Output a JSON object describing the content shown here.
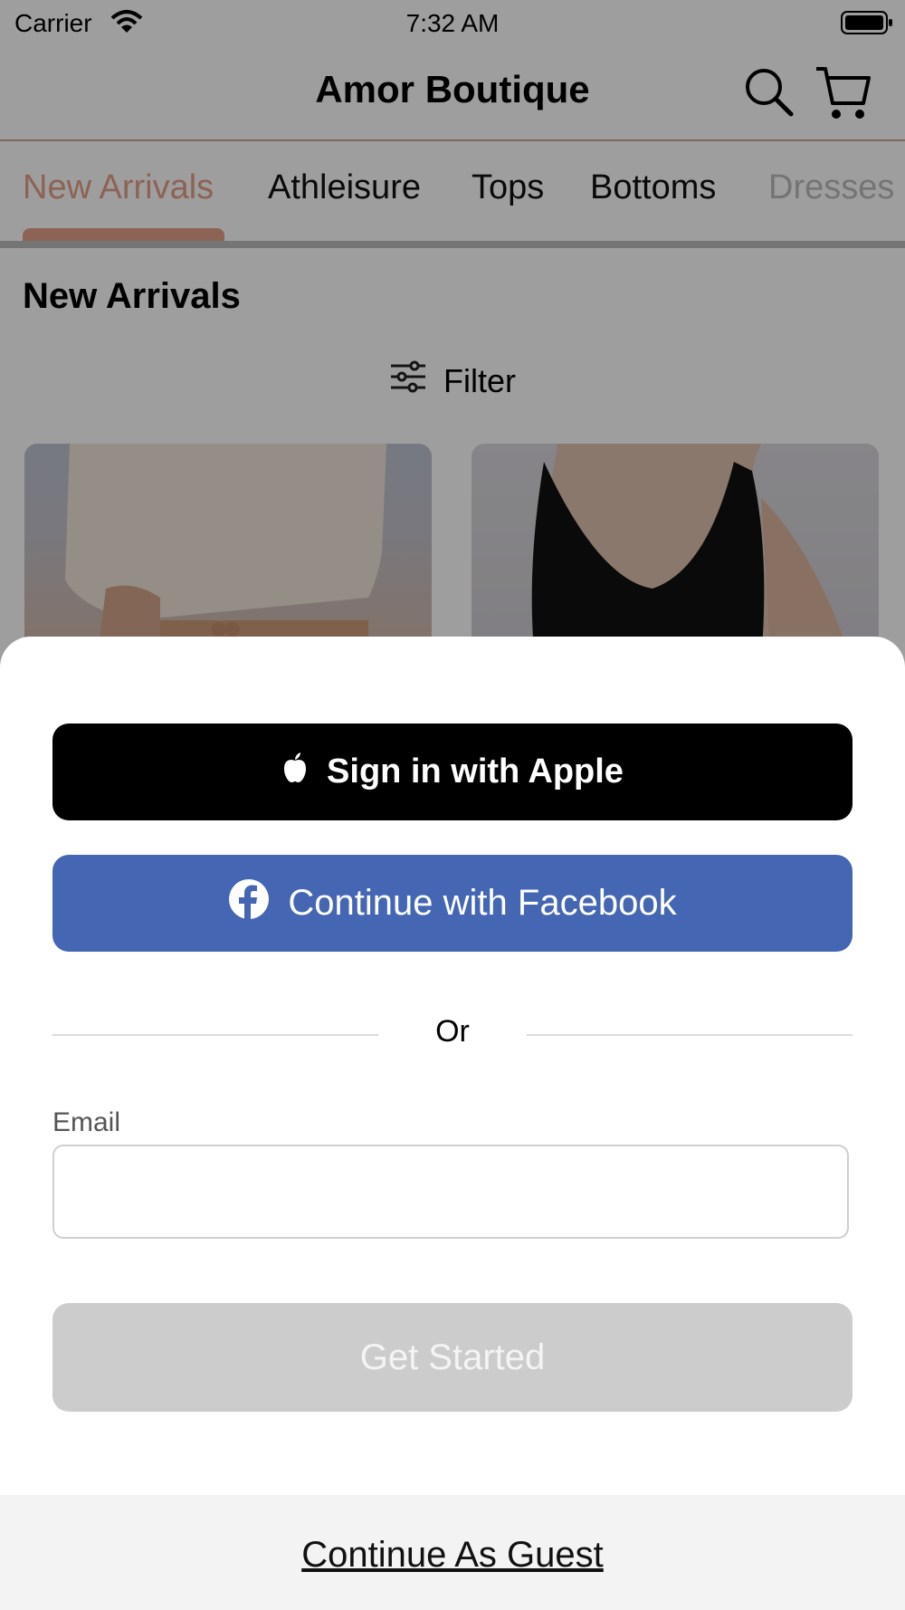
{
  "status_bar": {
    "carrier": "Carrier",
    "time": "7:32 AM"
  },
  "header": {
    "title": "Amor Boutique"
  },
  "tabs": [
    {
      "label": "New Arrivals",
      "active": true
    },
    {
      "label": "Athleisure"
    },
    {
      "label": "Tops"
    },
    {
      "label": "Bottoms"
    },
    {
      "label": "Dresses"
    }
  ],
  "section": {
    "title": "New Arrivals",
    "filter_label": "Filter"
  },
  "sheet": {
    "apple_label": "Sign in with Apple",
    "facebook_label": "Continue with Facebook",
    "or_label": "Or",
    "email_label": "Email",
    "email_value": "",
    "get_started_label": "Get Started",
    "guest_label": "Continue As Guest"
  },
  "colors": {
    "accent": "#e2a089",
    "facebook": "#4466b3",
    "disabled": "#cccccc"
  }
}
